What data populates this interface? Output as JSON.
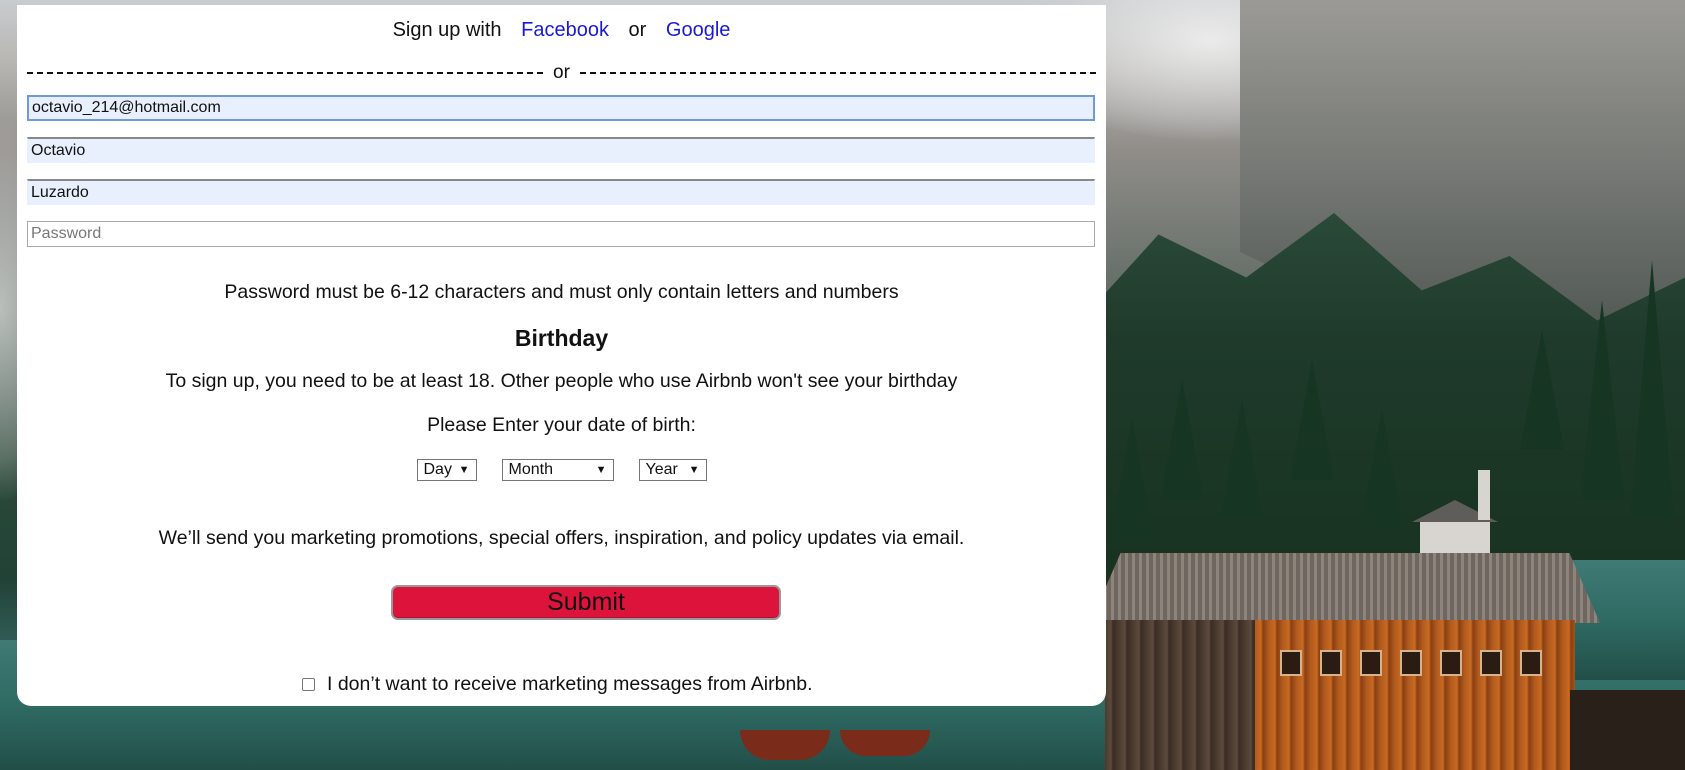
{
  "social": {
    "prefix": "Sign up with",
    "facebook_label": "Facebook",
    "or_label": "or",
    "google_label": "Google"
  },
  "divider": {
    "label": "or"
  },
  "fields": {
    "email_value": "octavio_214@hotmail.com",
    "first_name_value": "Octavio",
    "last_name_value": "Luzardo",
    "password_placeholder": "Password"
  },
  "password_hint": "Password must be 6-12 characters and must only contain letters and numbers",
  "birthday": {
    "heading": "Birthday",
    "age_note": "To sign up, you need to be at least 18. Other people who use Airbnb won't see your birthday",
    "prompt": "Please Enter your date of birth:",
    "day_label": "Day",
    "month_label": "Month",
    "year_label": "Year"
  },
  "marketing_note": "We’ll send you marketing promotions, special offers, inspiration, and policy updates via email.",
  "submit_label": "Submit",
  "optout_label": "I don’t want to receive marketing messages from Airbnb.",
  "colors": {
    "submit_bg": "#dc143c",
    "link": "#1a1ad6",
    "autofill_bg": "#e8f0fe"
  },
  "icons": {
    "select_caret": "▼"
  }
}
